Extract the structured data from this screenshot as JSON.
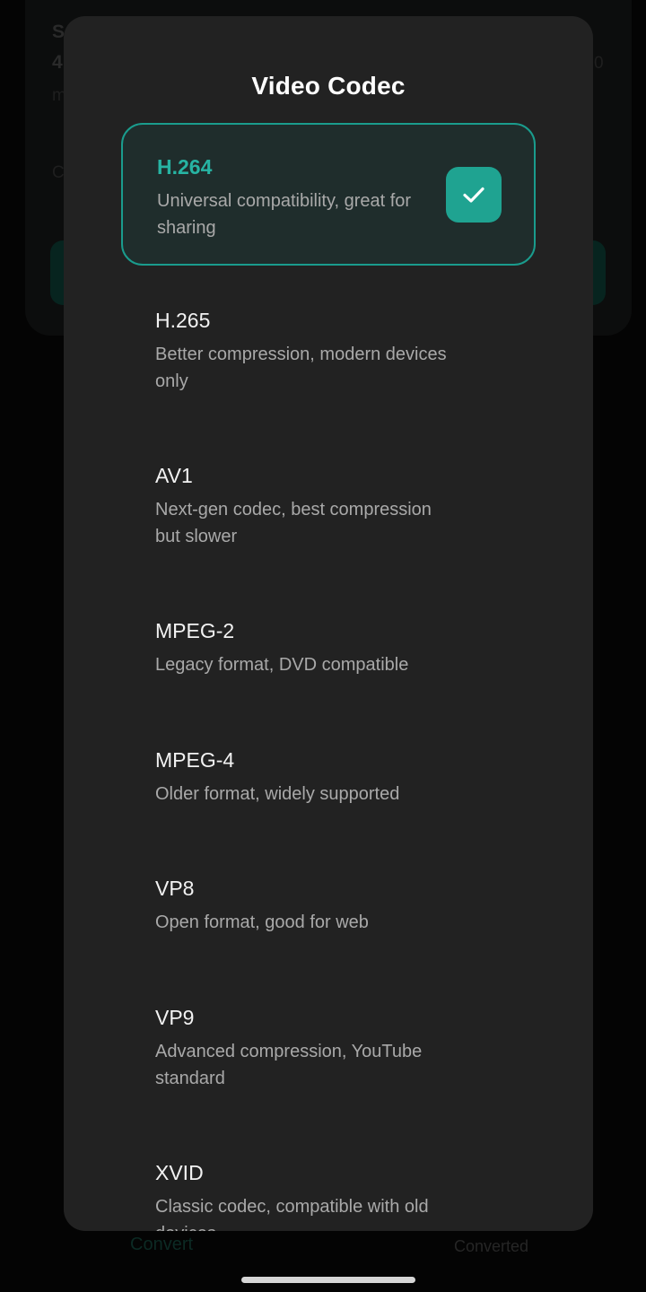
{
  "dialog": {
    "title": "Video Codec",
    "options": [
      {
        "name": "H.264",
        "description": "Universal compatibility, great for sharing",
        "selected": true
      },
      {
        "name": "H.265",
        "description": "Better compression, modern devices only",
        "selected": false
      },
      {
        "name": "AV1",
        "description": "Next-gen codec, best compression but slower",
        "selected": false
      },
      {
        "name": "MPEG-2",
        "description": "Legacy format, DVD compatible",
        "selected": false
      },
      {
        "name": "MPEG-4",
        "description": "Older format, widely supported",
        "selected": false
      },
      {
        "name": "VP8",
        "description": "Open format, good for web",
        "selected": false
      },
      {
        "name": "VP9",
        "description": "Advanced compression, YouTube standard",
        "selected": false
      },
      {
        "name": "XVID",
        "description": "Classic codec, compatible with old devices",
        "selected": false
      }
    ]
  },
  "background": {
    "card_lines": [
      "S",
      "4",
      "m",
      "C"
    ],
    "card_right_fragment": "0",
    "bottom_nav": {
      "convert_label": "Convert",
      "converted_label": "Converted"
    }
  },
  "colors": {
    "accent": "#1fa391",
    "selected_text": "#27b4a3",
    "dialog_bg": "#222222"
  }
}
